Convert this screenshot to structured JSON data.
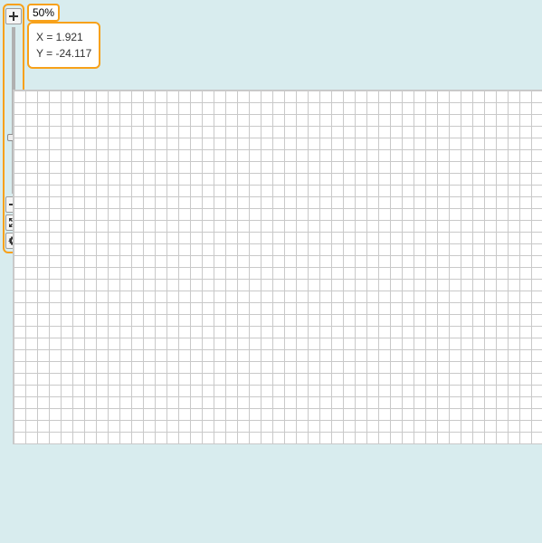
{
  "zoom": {
    "level_label": "50%"
  },
  "coords": {
    "x_label": "X = 1.921",
    "y_label": "Y = -24.117"
  }
}
